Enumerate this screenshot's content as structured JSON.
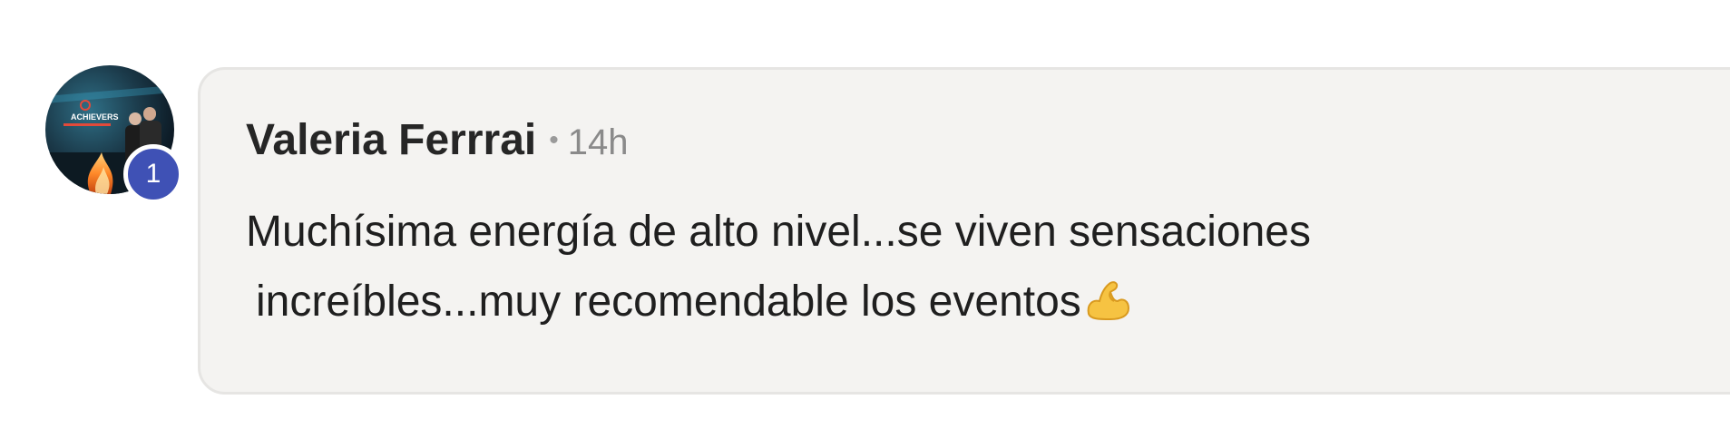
{
  "comment": {
    "author": "Valeria Ferrrai",
    "separator": "•",
    "timestamp": "14h",
    "text_line_1": "Muchísima energía de alto nivel...se viven sensaciones",
    "text_line_2": "increíbles...muy recomendable los eventos",
    "emoji": "flexed-biceps-emoji",
    "badge_count": "1",
    "avatar_image": {
      "banner_text": "ACHIEVERS"
    }
  },
  "colors": {
    "badge": "#3f51b5",
    "bubble_background": "#f4f3f1",
    "bubble_border": "#e6e5e3",
    "author_text": "#262626",
    "timestamp_text": "#8a8a8a"
  }
}
